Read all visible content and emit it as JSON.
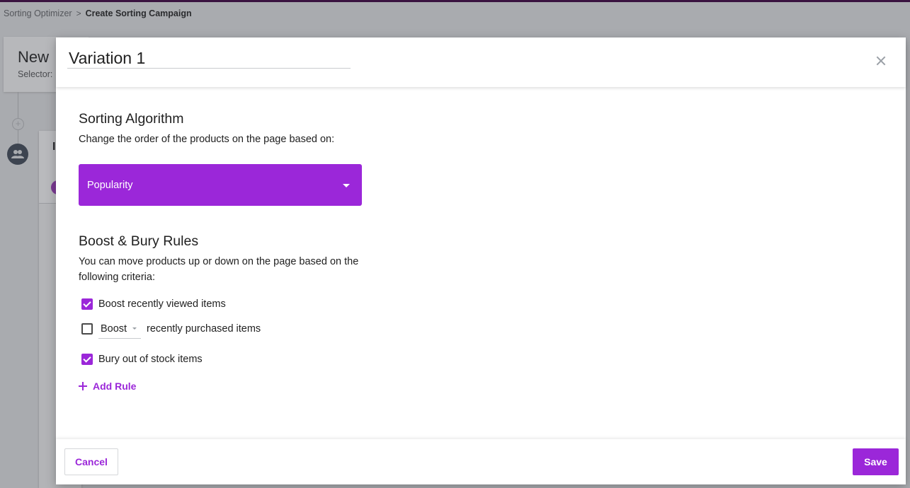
{
  "breadcrumb": {
    "parent": "Sorting Optimizer",
    "separator": ">",
    "current": "Create Sorting Campaign"
  },
  "background": {
    "title": "New",
    "subtitle": "Selector:",
    "panel_mark": "I"
  },
  "modal": {
    "title": "Variation 1",
    "close_icon": "close-icon",
    "sorting": {
      "title": "Sorting Algorithm",
      "description": "Change the order of the products on the page based on:",
      "selected": "Popularity"
    },
    "boost_bury": {
      "title": "Boost & Bury Rules",
      "description": "You can move products up or down on the page based on the following criteria:",
      "rules": [
        {
          "checked": true,
          "label": "Boost recently viewed items"
        },
        {
          "checked": false,
          "action": "Boost",
          "label": "recently purchased items"
        },
        {
          "checked": true,
          "label": "Bury out of stock items"
        }
      ],
      "add_rule_label": "Add Rule"
    },
    "footer": {
      "cancel_label": "Cancel",
      "save_label": "Save"
    }
  },
  "colors": {
    "accent": "#9b27d9",
    "overlay": "#a9abaf",
    "topbar": "#3a1340"
  }
}
